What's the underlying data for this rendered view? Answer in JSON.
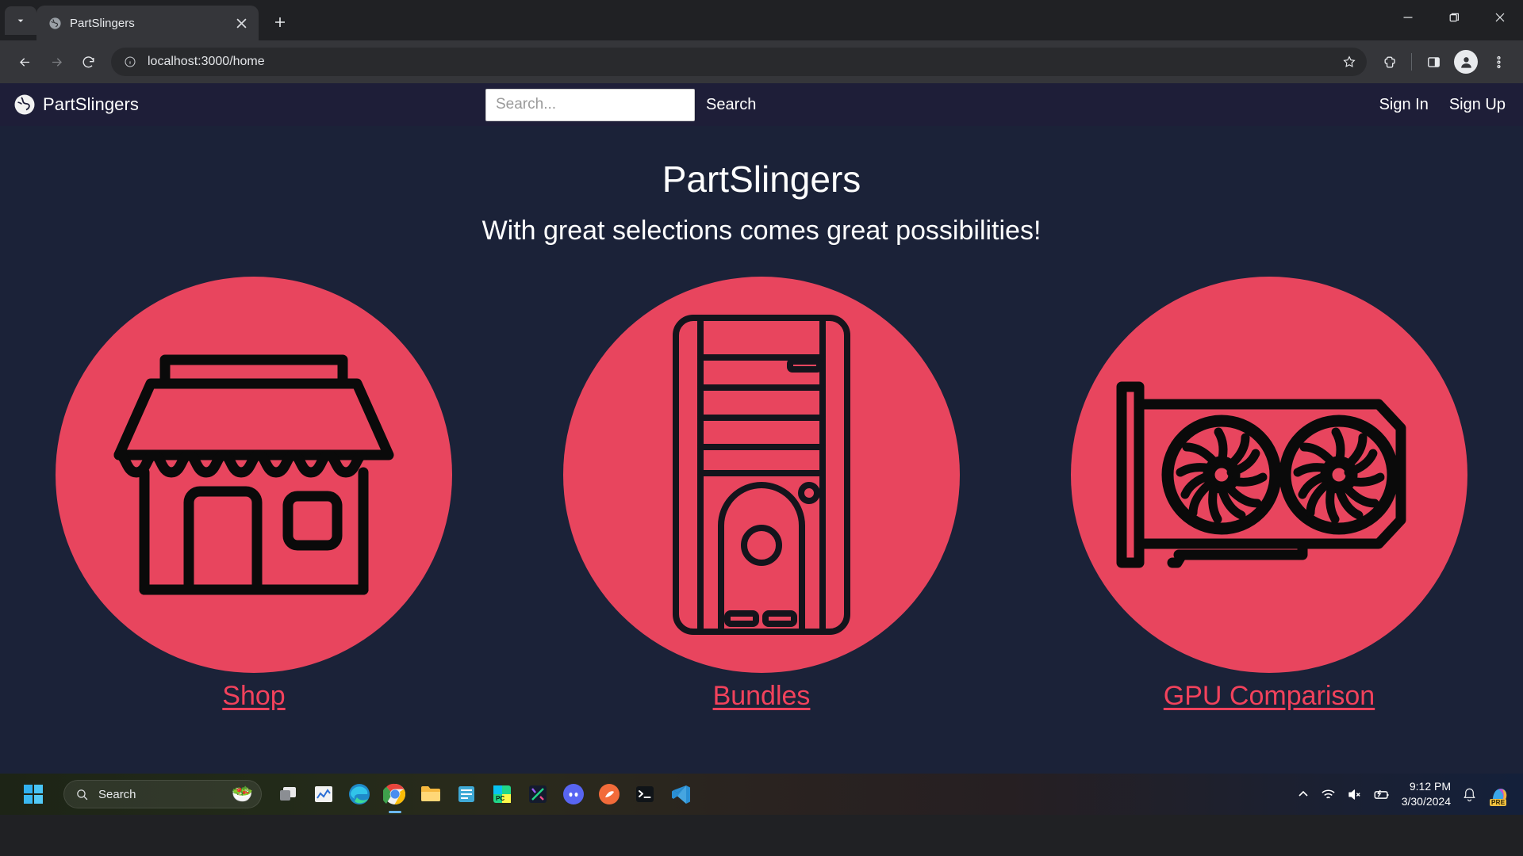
{
  "browser": {
    "tab": {
      "title": "PartSlingers",
      "favicon": "globe-icon"
    },
    "new_tab_label": "+",
    "url": "localhost:3000/home",
    "window_controls": {
      "minimize": "minimize-icon",
      "maximize": "maximize-icon",
      "close": "close-icon"
    },
    "toolbar_icons": [
      "back-icon",
      "forward-icon",
      "reload-icon",
      "site-info-icon",
      "bookmark-star-icon",
      "extensions-icon",
      "side-panel-icon",
      "profile-avatar-icon",
      "chrome-menu-icon"
    ]
  },
  "site": {
    "navbar": {
      "brand": "PartSlingers",
      "brand_logo": "globe-icon",
      "search_placeholder": "Search...",
      "search_value": "",
      "search_button": "Search",
      "sign_in": "Sign In",
      "sign_up": "Sign Up"
    },
    "hero": {
      "title": "PartSlingers",
      "subtitle": "With great selections comes great possibilities!"
    },
    "cards": [
      {
        "icon": "storefront-icon",
        "label": "Shop"
      },
      {
        "icon": "pc-tower-icon",
        "label": "Bundles"
      },
      {
        "icon": "gpu-icon",
        "label": "GPU Comparison"
      }
    ],
    "colors": {
      "page_bg": "#1b2238",
      "navbar_bg": "#1e1e38",
      "accent_pink": "#e8455e",
      "link_pink": "#f2425c",
      "text_white": "#ffffff"
    }
  },
  "taskbar": {
    "start": "windows-start-icon",
    "search_placeholder": "Search",
    "search_emoji": "salad-emoji",
    "apps": [
      "task-view-icon",
      "widgets-chart-icon",
      "edge-browser-icon",
      "chrome-browser-icon",
      "file-explorer-icon",
      "notepad-icon",
      "pycharm-icon",
      "datagrip-icon",
      "discord-icon",
      "postman-icon",
      "terminal-icon",
      "vscode-icon"
    ],
    "tray": {
      "show_hidden": "chevron-up-icon",
      "wifi": "wifi-icon",
      "volume": "volume-muted-icon",
      "battery": "battery-charging-icon",
      "time": "9:12 PM",
      "date": "3/30/2024",
      "notifications": "bell-icon",
      "copilot": "copilot-icon",
      "copilot_badge": "PRE"
    }
  }
}
